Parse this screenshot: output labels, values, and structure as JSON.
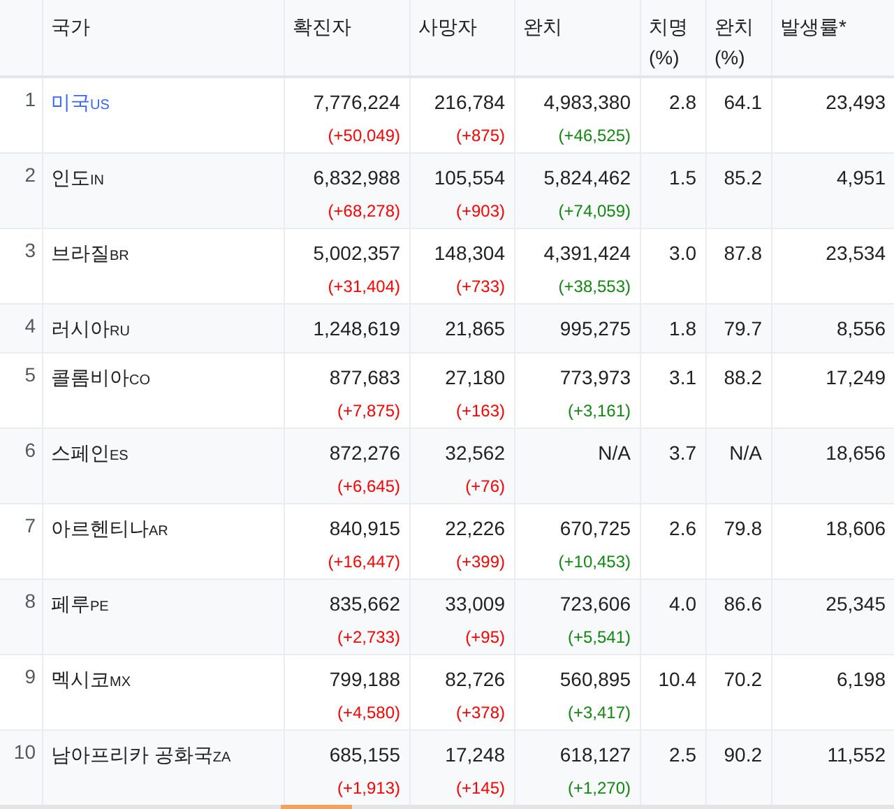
{
  "table": {
    "columns": [
      "국가",
      "확진자",
      "사망자",
      "완치",
      "치명\n(%)",
      "완치\n(%)",
      "발생률*"
    ],
    "rows": [
      {
        "rank": "1",
        "country": "미국",
        "code": "US",
        "selected": true,
        "confirmed": "7,776,224",
        "confirmed_change": "(+50,049)",
        "deaths": "216,784",
        "deaths_change": "(+875)",
        "recovered": "4,983,380",
        "recovered_change": "(+46,525)",
        "fatality": "2.8",
        "recovery": "64.1",
        "incidence": "23,493"
      },
      {
        "rank": "2",
        "country": "인도",
        "code": "IN",
        "selected": false,
        "confirmed": "6,832,988",
        "confirmed_change": "(+68,278)",
        "deaths": "105,554",
        "deaths_change": "(+903)",
        "recovered": "5,824,462",
        "recovered_change": "(+74,059)",
        "fatality": "1.5",
        "recovery": "85.2",
        "incidence": "4,951"
      },
      {
        "rank": "3",
        "country": "브라질",
        "code": "BR",
        "selected": false,
        "confirmed": "5,002,357",
        "confirmed_change": "(+31,404)",
        "deaths": "148,304",
        "deaths_change": "(+733)",
        "recovered": "4,391,424",
        "recovered_change": "(+38,553)",
        "fatality": "3.0",
        "recovery": "87.8",
        "incidence": "23,534"
      },
      {
        "rank": "4",
        "country": "러시아",
        "code": "RU",
        "selected": false,
        "confirmed": "1,248,619",
        "deaths": "21,865",
        "recovered": "995,275",
        "fatality": "1.8",
        "recovery": "79.7",
        "incidence": "8,556"
      },
      {
        "rank": "5",
        "country": "콜롬비아",
        "code": "CO",
        "selected": false,
        "confirmed": "877,683",
        "confirmed_change": "(+7,875)",
        "deaths": "27,180",
        "deaths_change": "(+163)",
        "recovered": "773,973",
        "recovered_change": "(+3,161)",
        "fatality": "3.1",
        "recovery": "88.2",
        "incidence": "17,249"
      },
      {
        "rank": "6",
        "country": "스페인",
        "code": "ES",
        "selected": false,
        "confirmed": "872,276",
        "confirmed_change": "(+6,645)",
        "deaths": "32,562",
        "deaths_change": "(+76)",
        "recovered": "N/A",
        "fatality": "3.7",
        "recovery": "N/A",
        "incidence": "18,656"
      },
      {
        "rank": "7",
        "country": "아르헨티나",
        "code": "AR",
        "selected": false,
        "confirmed": "840,915",
        "confirmed_change": "(+16,447)",
        "deaths": "22,226",
        "deaths_change": "(+399)",
        "recovered": "670,725",
        "recovered_change": "(+10,453)",
        "fatality": "2.6",
        "recovery": "79.8",
        "incidence": "18,606"
      },
      {
        "rank": "8",
        "country": "페루",
        "code": "PE",
        "selected": false,
        "confirmed": "835,662",
        "confirmed_change": "(+2,733)",
        "deaths": "33,009",
        "deaths_change": "(+95)",
        "recovered": "723,606",
        "recovered_change": "(+5,541)",
        "fatality": "4.0",
        "recovery": "86.6",
        "incidence": "25,345"
      },
      {
        "rank": "9",
        "country": "멕시코",
        "code": "MX",
        "selected": false,
        "confirmed": "799,188",
        "confirmed_change": "(+4,580)",
        "deaths": "82,726",
        "deaths_change": "(+378)",
        "recovered": "560,895",
        "recovered_change": "(+3,417)",
        "fatality": "10.4",
        "recovery": "70.2",
        "incidence": "6,198"
      },
      {
        "rank": "10",
        "country": "남아프리카 공화국",
        "code": "ZA",
        "selected": false,
        "confirmed": "685,155",
        "confirmed_change": "(+1,913)",
        "deaths": "17,248",
        "deaths_change": "(+145)",
        "recovered": "618,127",
        "recovered_change": "(+1,270)",
        "fatality": "2.5",
        "recovery": "90.2",
        "incidence": "11,552"
      }
    ]
  }
}
